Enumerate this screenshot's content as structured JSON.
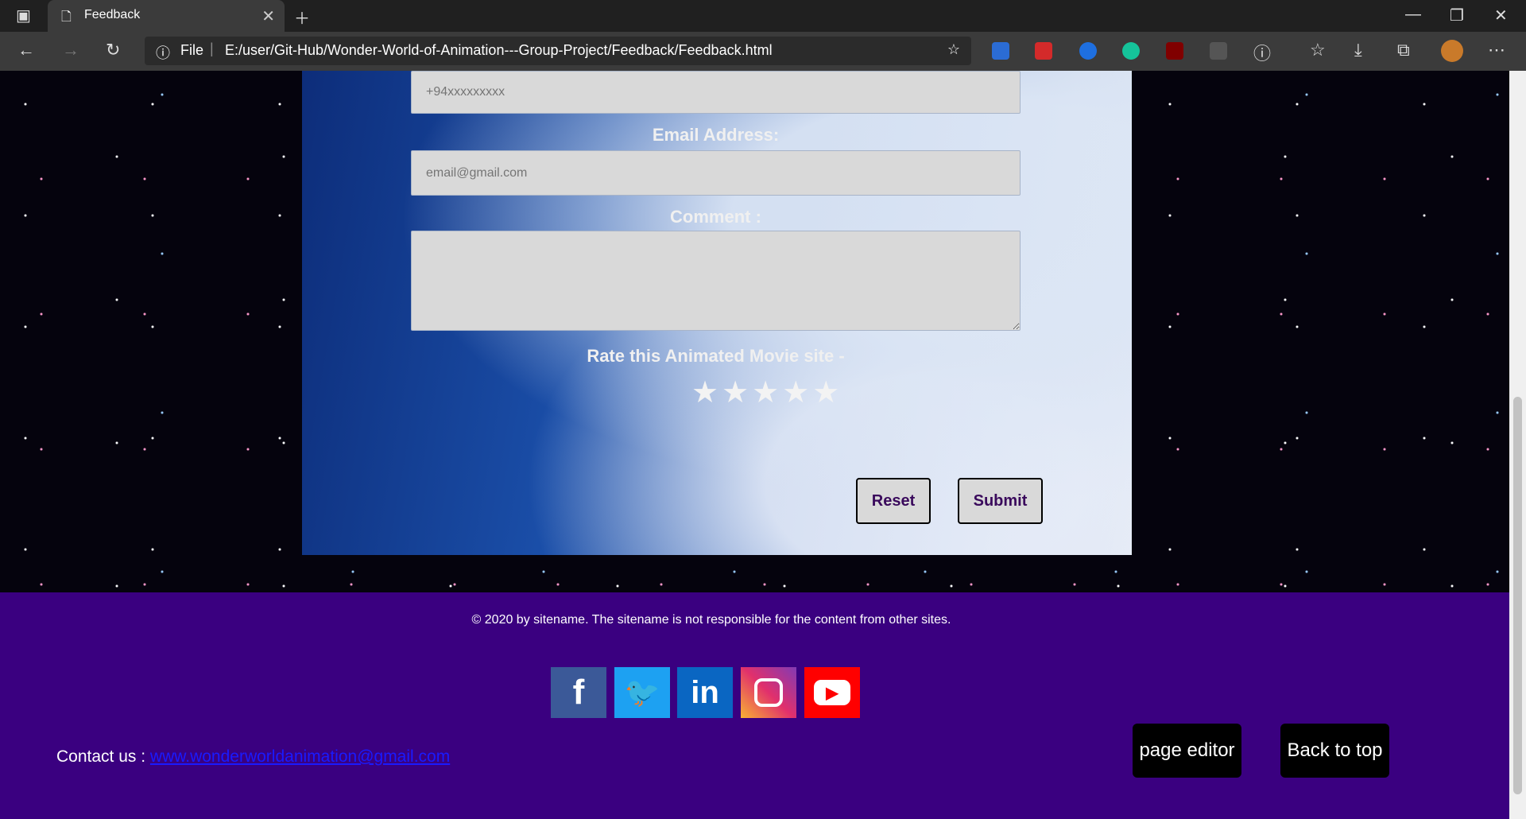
{
  "browser": {
    "tab_title": "Feedback",
    "url_prefix": "File",
    "url": "E:/user/Git-Hub/Wonder-World-of-Animation---Group-Project/Feedback/Feedback.html"
  },
  "form": {
    "phone_placeholder": "+94xxxxxxxxx",
    "email_label": "Email Address:",
    "email_placeholder": "email@gmail.com",
    "comment_label": "Comment :",
    "rating_label": "Rate this Animated Movie site -",
    "stars": "★★★★★",
    "reset_label": "Reset",
    "submit_label": "Submit"
  },
  "footer": {
    "copyright": "© 2020 by sitename. The sitename is not responsible for the content from other sites.",
    "contact_label": "Contact us :",
    "contact_link": "www.wonderworldanimation@gmail.com",
    "page_editor_label": "page editor",
    "back_to_top_label": "Back to top",
    "social": [
      "facebook",
      "twitter",
      "linkedin",
      "instagram",
      "youtube"
    ]
  }
}
